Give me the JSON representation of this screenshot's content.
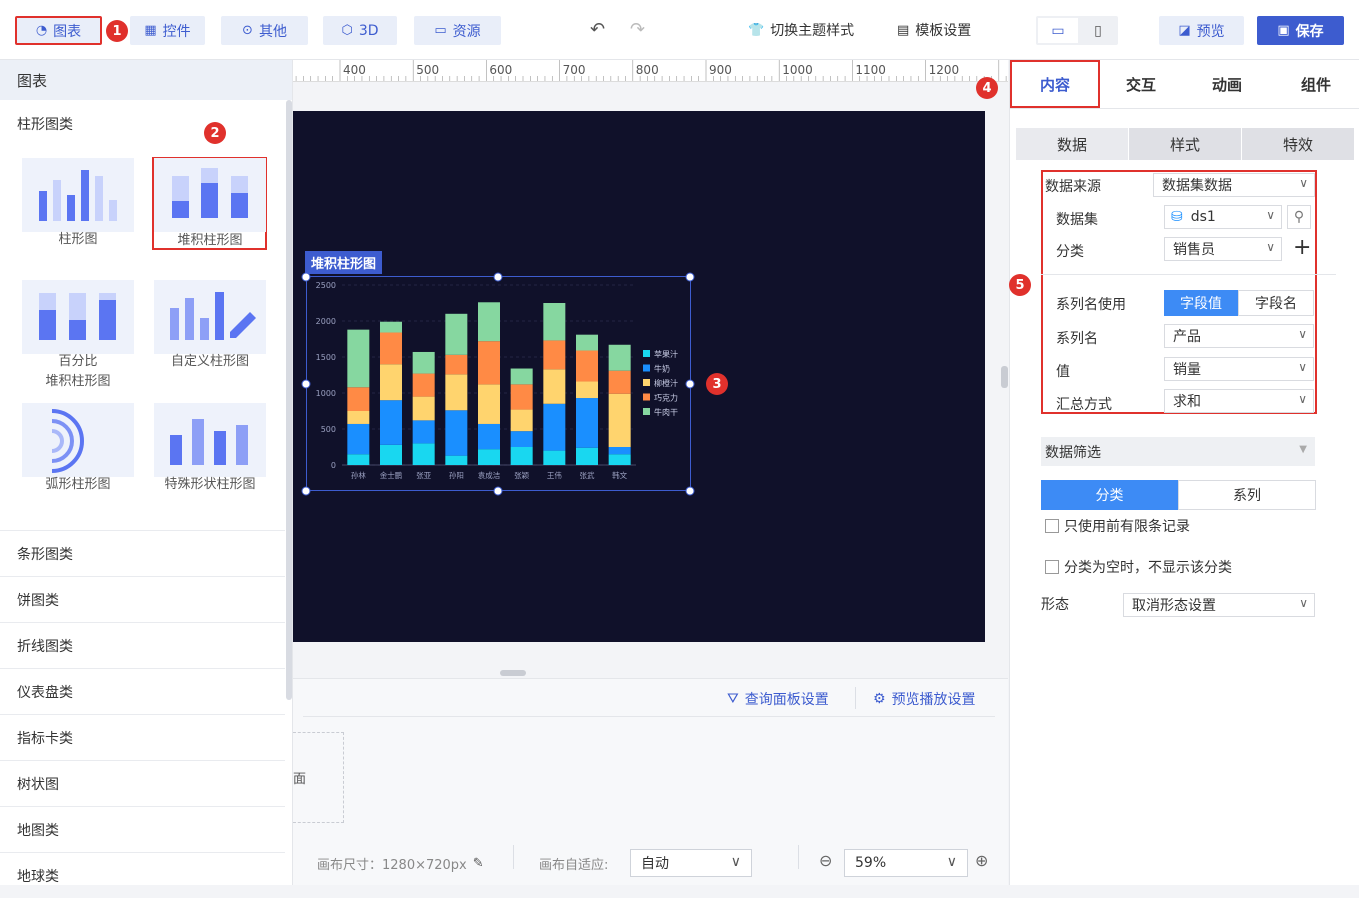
{
  "toolbar": {
    "chart": "图表",
    "control": "控件",
    "other": "其他",
    "threed": "3D",
    "resource": "资源",
    "theme": "切换主题样式",
    "template": "模板设置",
    "preview": "预览",
    "save": "保存"
  },
  "badges": [
    "1",
    "2",
    "3",
    "4",
    "5"
  ],
  "left_panel": {
    "title": "图表",
    "section": "柱形图类",
    "charts": [
      {
        "label": "柱形图"
      },
      {
        "label": "堆积柱形图"
      },
      {
        "label": "百分比"
      },
      {
        "label": "堆积柱形图"
      },
      {
        "label": "自定义柱形图"
      },
      {
        "label": "弧形柱形图"
      },
      {
        "label": "特殊形状柱形图"
      }
    ],
    "categories": [
      "条形图类",
      "饼图类",
      "折线图类",
      "仪表盘类",
      "指标卡类",
      "树状图",
      "地图类",
      "地球类"
    ]
  },
  "ruler": [
    "400",
    "500",
    "600",
    "700",
    "800",
    "900",
    "1000",
    "1100",
    "1200"
  ],
  "chart_widget": {
    "title": "堆积柱形图"
  },
  "chart_data": {
    "type": "bar",
    "stacked": true,
    "categories": [
      "孙林",
      "金士鹏",
      "张亚",
      "孙阳",
      "袁成洁",
      "张颖",
      "王伟",
      "张武",
      "韩文"
    ],
    "ylim": [
      0,
      2500
    ],
    "yticks": [
      "0",
      "500",
      "1000",
      "1500",
      "2000",
      "2500"
    ],
    "legend_position": "right",
    "series": [
      {
        "name": "苹果汁",
        "color": "#19d7f0",
        "values": [
          150,
          280,
          300,
          130,
          220,
          250,
          200,
          240,
          150
        ]
      },
      {
        "name": "牛奶",
        "color": "#1a8fff",
        "values": [
          420,
          620,
          320,
          630,
          350,
          220,
          650,
          690,
          100
        ]
      },
      {
        "name": "柳橙汁",
        "color": "#ffd46e",
        "values": [
          180,
          500,
          330,
          500,
          550,
          300,
          480,
          230,
          740
        ]
      },
      {
        "name": "巧克力",
        "color": "#ff8a45",
        "values": [
          330,
          440,
          320,
          270,
          600,
          350,
          400,
          430,
          320
        ]
      },
      {
        "name": "牛肉干",
        "color": "#86d7a0",
        "values": [
          800,
          150,
          300,
          570,
          540,
          220,
          520,
          220,
          360
        ]
      }
    ]
  },
  "bottom_pane": {
    "query": "查询面板设置",
    "playback": "预览播放设置",
    "placeholder": "面"
  },
  "statusbar": {
    "canvas_size": "画布尺寸：1280×720px",
    "adapt_label": "画布自适应:",
    "adapt_value": "自动",
    "zoom": "59%"
  },
  "right_panel": {
    "tabs": [
      "内容",
      "交互",
      "动画",
      "组件"
    ],
    "subtabs": [
      "数据",
      "样式",
      "特效"
    ],
    "source_label": "数据来源",
    "source_value": "数据集数据",
    "dataset_label": "数据集",
    "dataset_value": "ds1",
    "category_label": "分类",
    "category_value": "销售员",
    "series_use_label": "系列名使用",
    "series_opt1": "字段值",
    "series_opt2": "字段名",
    "series_name_label": "系列名",
    "series_name_value": "产品",
    "value_label": "值",
    "value_value": "销量",
    "agg_label": "汇总方式",
    "agg_value": "求和",
    "filter_title": "数据筛选",
    "filter_tab1": "分类",
    "filter_tab2": "系列",
    "check1": "只使用前有限条记录",
    "check2": "分类为空时，不显示该分类",
    "state_label": "形态",
    "state_value": "取消形态设置"
  }
}
